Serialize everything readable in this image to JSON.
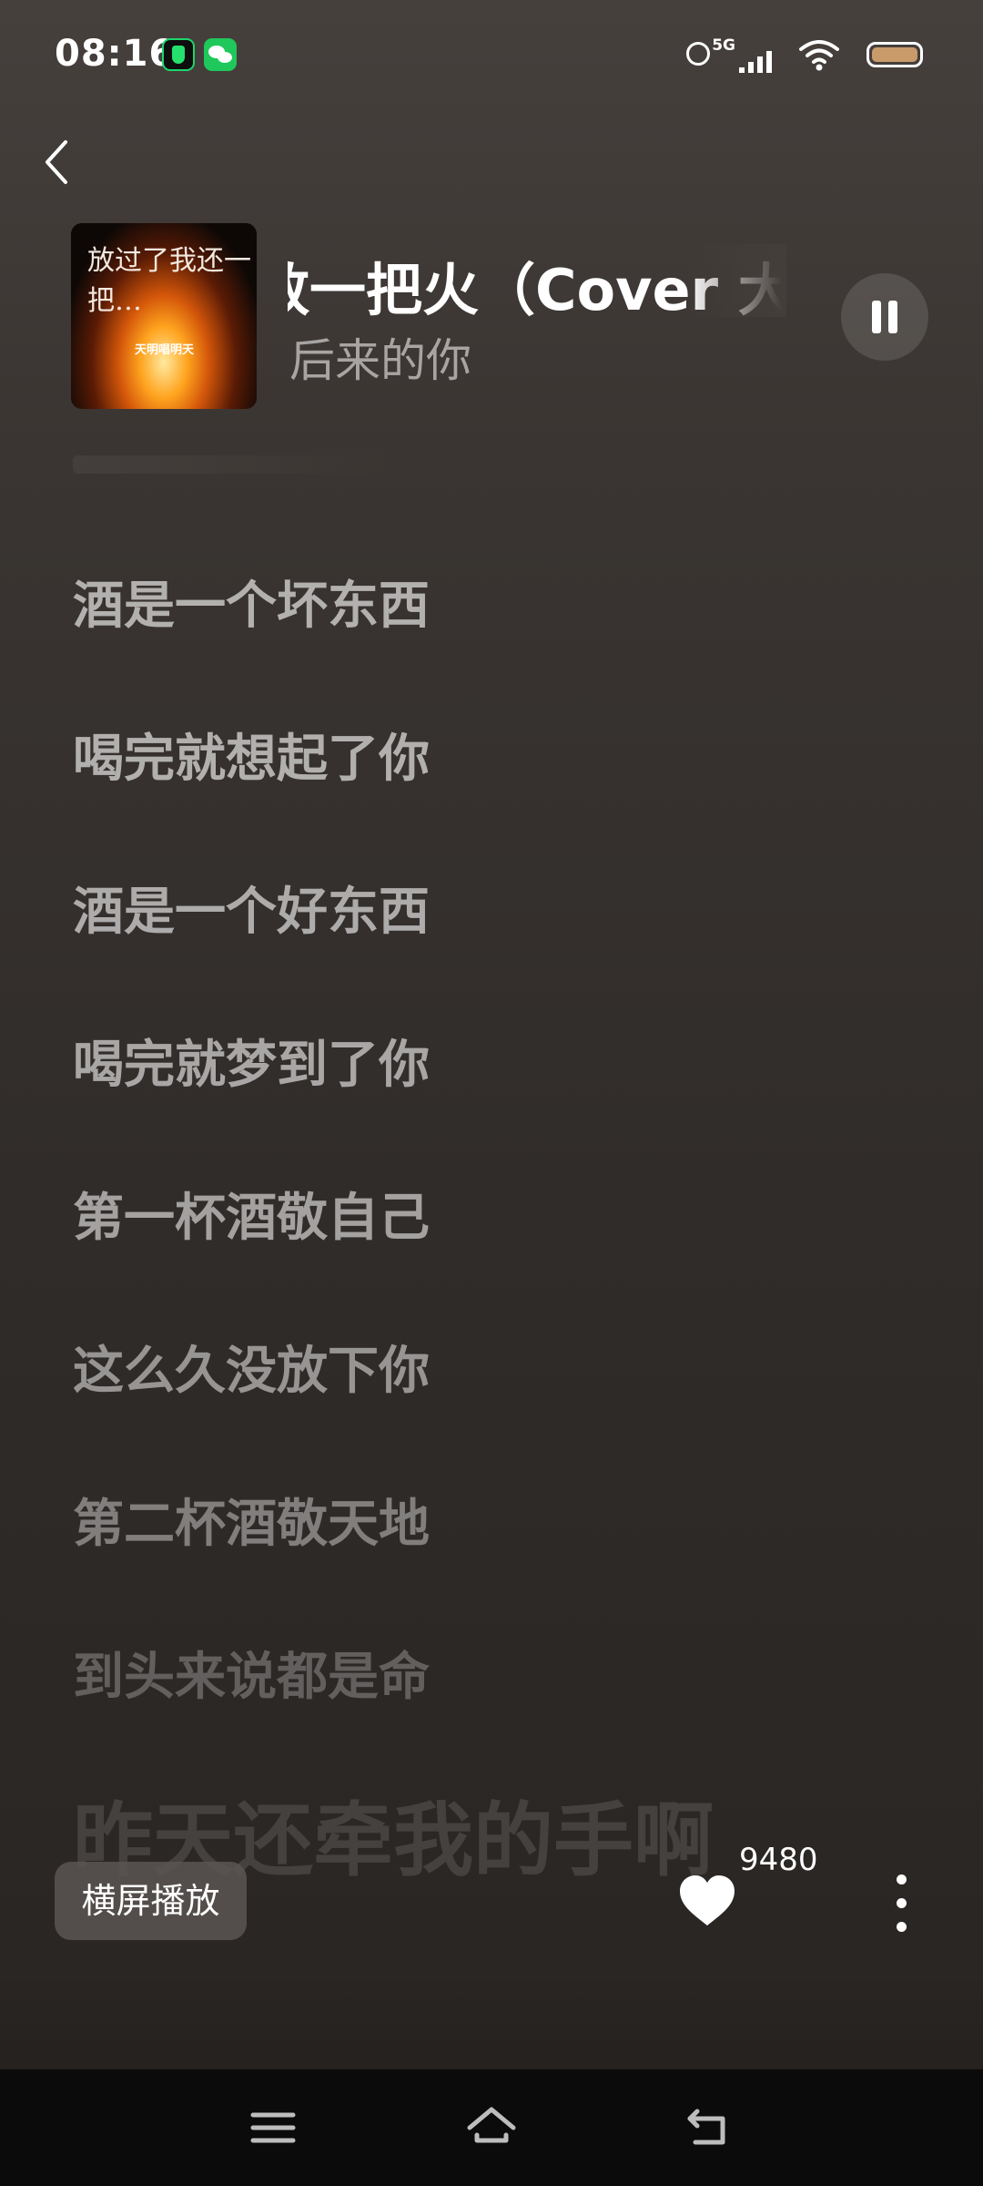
{
  "status_bar": {
    "time": "08:16",
    "network": "5G",
    "app_icons": [
      "qq-music-icon",
      "wechat-icon"
    ]
  },
  "header": {
    "back_icon": "chevron-left-icon"
  },
  "song": {
    "cover_text": "放过了我还一把…",
    "cover_subtext": "天明唱明天",
    "title": "敬一把火（Cover 大霞）",
    "artist": "后来的你",
    "play_state_icon": "pause-icon"
  },
  "lyrics": [
    {
      "text": "酒是一个坏东西",
      "opacity": 0.62
    },
    {
      "text": "喝完就想起了你",
      "opacity": 0.62
    },
    {
      "text": "酒是一个好东西",
      "opacity": 0.6
    },
    {
      "text": "喝完就梦到了你",
      "opacity": 0.58
    },
    {
      "text": "第一杯酒敬自己",
      "opacity": 0.56
    },
    {
      "text": "这么久没放下你",
      "opacity": 0.5
    },
    {
      "text": "第二杯酒敬天地",
      "opacity": 0.4
    },
    {
      "text": "到头来说都是命",
      "opacity": 0.26
    },
    {
      "text": "昨天还牵我的手啊",
      "opacity": 0.12,
      "large": true
    }
  ],
  "controls": {
    "landscape_label": "横屏播放",
    "like_count": "9480",
    "like_icon": "heart-icon",
    "more_icon": "more-vertical-icon"
  },
  "nav_bar": {
    "icons": [
      "menu-icon",
      "home-icon",
      "back-icon"
    ]
  },
  "colors": {
    "background": "#3a3532",
    "text_primary": "#ffffff",
    "battery": "#c99a6a",
    "nav_bar": "#0b0b0b"
  }
}
